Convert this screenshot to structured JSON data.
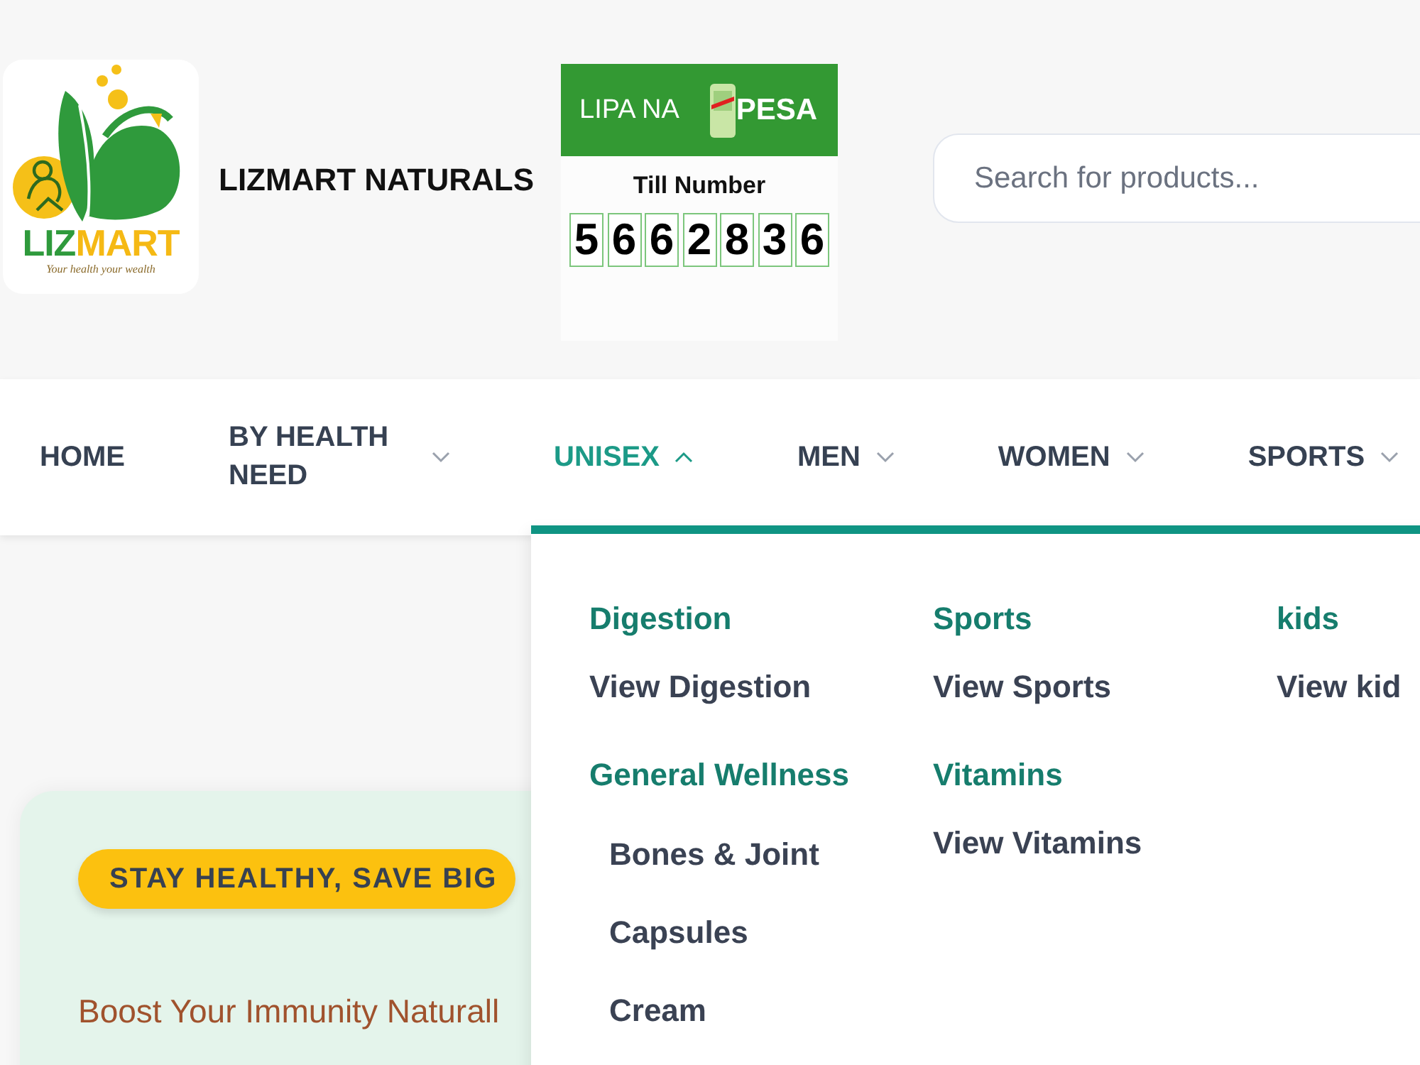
{
  "header": {
    "logo": {
      "wordmark": [
        "LIZ",
        "MART"
      ],
      "tagline": "Your health your wealth"
    },
    "brand_name": "LIZMART NATURALS",
    "payment_card": {
      "banner_left": "LIPA NA",
      "banner_right": "PESA",
      "label": "Till Number",
      "digits": [
        "5",
        "6",
        "6",
        "2",
        "8",
        "3",
        "6"
      ]
    },
    "search": {
      "placeholder": "Search for products..."
    }
  },
  "nav": {
    "items": [
      {
        "label": "HOME",
        "kind": "link",
        "selected": false
      },
      {
        "label": "BY HEALTH NEED",
        "kind": "menu",
        "selected": false,
        "expanded": false
      },
      {
        "label": "UNISEX",
        "kind": "menu",
        "selected": true,
        "expanded": true
      },
      {
        "label": "MEN",
        "kind": "menu",
        "selected": false,
        "expanded": false
      },
      {
        "label": "WOMEN",
        "kind": "menu",
        "selected": false,
        "expanded": false
      },
      {
        "label": "SPORTS",
        "kind": "menu",
        "selected": false,
        "expanded": false
      }
    ]
  },
  "mega_menu": {
    "columns": [
      {
        "groups": [
          {
            "title": "Digestion",
            "items": [
              {
                "label": "View Digestion",
                "kind": "view"
              }
            ]
          },
          {
            "title": "General Wellness",
            "items": [
              {
                "label": "Bones & Joint",
                "kind": "sub"
              },
              {
                "label": "Capsules",
                "kind": "sub"
              },
              {
                "label": "Cream",
                "kind": "sub"
              }
            ]
          }
        ]
      },
      {
        "groups": [
          {
            "title": "Sports",
            "items": [
              {
                "label": "View Sports",
                "kind": "view"
              }
            ]
          },
          {
            "title": "Vitamins",
            "items": [
              {
                "label": "View Vitamins",
                "kind": "view"
              }
            ]
          }
        ]
      },
      {
        "groups": [
          {
            "title": "kids",
            "items": [
              {
                "label": "View kid",
                "kind": "view"
              }
            ]
          }
        ]
      }
    ]
  },
  "hero": {
    "badge": "STAY HEALTHY, SAVE BIG",
    "headline": "Boost Your Immunity Naturall"
  }
}
